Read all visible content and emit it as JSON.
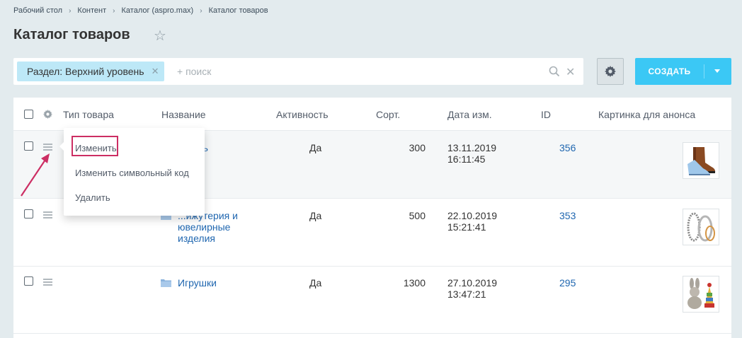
{
  "breadcrumb": [
    "Рабочий стол",
    "Контент",
    "Каталог (aspro.max)",
    "Каталог товаров"
  ],
  "page_title": "Каталог товаров",
  "search": {
    "chip_label": "Раздел: Верхний уровень",
    "placeholder": "+ поиск"
  },
  "create_button": "СОЗДАТЬ",
  "columns": [
    "Тип товара",
    "Название",
    "Активность",
    "Сорт.",
    "Дата изм.",
    "ID",
    "Картинка для анонса"
  ],
  "rows": [
    {
      "name": "...ь",
      "active": "Да",
      "sort": "300",
      "date": "13.11.2019",
      "time": "16:11:45",
      "id": "356",
      "image": "boot"
    },
    {
      "name1": "Бижутерия и",
      "name2": "ювелирные",
      "name3": "изделия",
      "name_visible1": "...ижутерия и",
      "active": "Да",
      "sort": "500",
      "date": "22.10.2019",
      "time": "15:21:41",
      "id": "353",
      "image": "bracelets"
    },
    {
      "name": "Игрушки",
      "active": "Да",
      "sort": "1300",
      "date": "27.10.2019",
      "time": "13:47:21",
      "id": "295",
      "image": "toys"
    }
  ],
  "context_menu": [
    "Изменить",
    "Изменить символьный код",
    "Удалить"
  ],
  "colors": {
    "accent": "#3bc8f5",
    "highlight": "#cc2e63",
    "link": "#2067b0"
  }
}
